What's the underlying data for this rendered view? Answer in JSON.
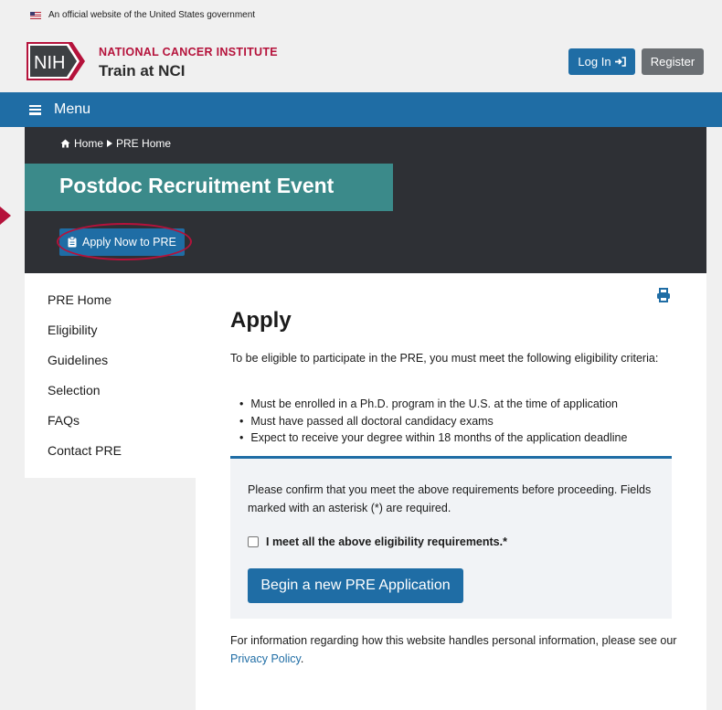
{
  "gov_banner": {
    "text": "An official website of the United States government"
  },
  "header": {
    "logo_text": "NIH",
    "org_name": "NATIONAL CANCER INSTITUTE",
    "site_title": "Train at NCI",
    "login_label": "Log In",
    "register_label": "Register"
  },
  "menu": {
    "label": "Menu"
  },
  "breadcrumb": {
    "home": "Home",
    "current": "PRE Home"
  },
  "hero": {
    "title": "Postdoc Recruitment Event",
    "apply_button": "Apply Now to PRE"
  },
  "sidebar": {
    "items": [
      {
        "label": "PRE Home"
      },
      {
        "label": "Eligibility"
      },
      {
        "label": "Guidelines"
      },
      {
        "label": "Selection"
      },
      {
        "label": "FAQs"
      },
      {
        "label": "Contact PRE"
      }
    ]
  },
  "main": {
    "title": "Apply",
    "intro": "To be eligible to participate in the PRE, you must meet the following eligibility criteria:",
    "criteria": [
      "Must be enrolled in a Ph.D. program in the U.S. at the time of application",
      "Must have passed all doctoral candidacy exams",
      "Expect to receive your degree within 18 months of the application deadline"
    ],
    "confirm_text": "Please confirm that you meet the above requirements before proceeding. Fields marked with an asterisk (*) are required.",
    "checkbox_label": "I meet all the above eligibility requirements.*",
    "begin_button": "Begin a new PRE Application",
    "privacy_prefix": "For information regarding how this website handles personal information, please see our ",
    "privacy_link": "Privacy Policy",
    "privacy_suffix": "."
  },
  "colors": {
    "primary": "#1f6da5",
    "brand_red": "#b5123b",
    "hero_bg": "#2e3035",
    "title_band": "#3b8a8a"
  }
}
